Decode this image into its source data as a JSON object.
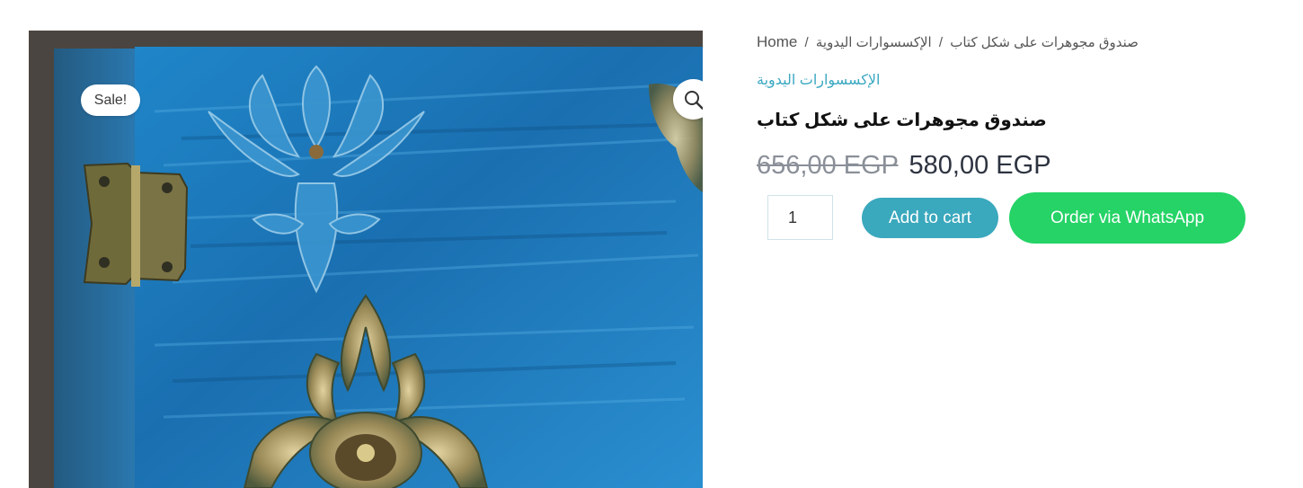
{
  "gallery": {
    "sale_badge": "Sale!",
    "zoom_icon": "magnifier-icon"
  },
  "breadcrumb": {
    "home": "Home",
    "separator": "/",
    "category": "الإكسسوارات اليدوية",
    "current": "صندوق مجوهرات على شكل كتاب"
  },
  "product": {
    "category": "الإكسسوارات اليدوية",
    "title": "صندوق مجوهرات على شكل كتاب",
    "price_old": "656,00 EGP",
    "price_new": "580,00 EGP",
    "quantity": "1",
    "add_to_cart_label": "Add to cart",
    "whatsapp_label": "Order via WhatsApp"
  },
  "colors": {
    "accent": "#3aa8bd",
    "whatsapp": "#25d366",
    "old_price": "#8a8f98"
  }
}
